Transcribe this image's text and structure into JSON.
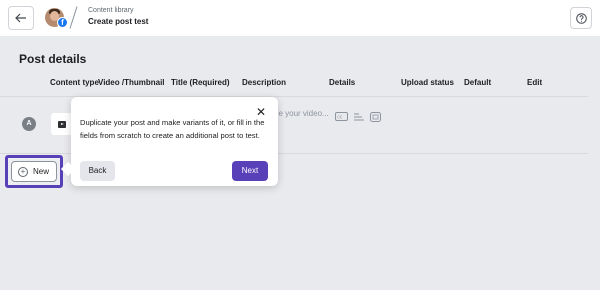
{
  "header": {
    "back_icon": "arrow-left-icon",
    "breadcrumb_parent": "Content library",
    "page_title": "Create post test",
    "help_icon": "question-circle-icon"
  },
  "section": {
    "title": "Post details"
  },
  "table": {
    "columns": [
      "Content type",
      "Video /Thumbnail",
      "Title (Required)",
      "Description",
      "Details",
      "Upload status",
      "Default",
      "Edit"
    ],
    "rows": [
      {
        "variant": "A",
        "thumbnail_icon": "video-icon",
        "description_placeholder": "be your video..."
      }
    ]
  },
  "new_button": {
    "label": "New",
    "icon": "plus-circle-icon"
  },
  "popover": {
    "text": "Duplicate your post and make variants of it, or fill in the fields from scratch to create an additional post to test.",
    "back_label": "Back",
    "next_label": "Next",
    "close_icon": "close-icon"
  },
  "colors": {
    "accent": "#5841b8",
    "background": "#e9eaed",
    "header_bg": "#ffffff"
  }
}
